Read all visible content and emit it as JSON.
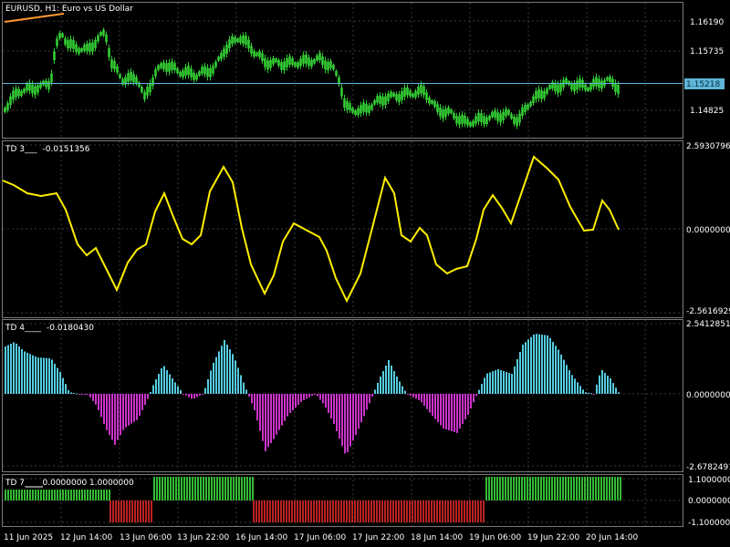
{
  "header": {
    "symbol_line": "EURUSD, H1:  Euro vs US Dollar",
    "price_tag": "1.15218"
  },
  "price_axis": {
    "labels": [
      "1.16190",
      "1.15735",
      "1.14825"
    ]
  },
  "panel_td3": {
    "name": "TD 3___",
    "value": "-0.0151356",
    "axis_labels": [
      "2.5930796",
      "0.0000000",
      "-2.5616929"
    ]
  },
  "panel_td4": {
    "name": "TD 4____",
    "value": "-0.0180430",
    "axis_labels": [
      "2.5412851",
      "0.0000000",
      "-2.6782491"
    ]
  },
  "panel_td7": {
    "name": "TD 7___",
    "values": "0.0000000  1.0000000",
    "axis_labels": [
      "1.1000000",
      "0.0000000",
      "-1.1000000"
    ]
  },
  "time_axis": {
    "labels": [
      "11 Jun 2025",
      "12 Jun 14:00",
      "13 Jun 06:00",
      "13 Jun 22:00",
      "16 Jun 14:00",
      "17 Jun 06:00",
      "17 Jun 22:00",
      "18 Jun 14:00",
      "19 Jun 06:00",
      "19 Jun 22:00",
      "20 Jun 14:00"
    ]
  },
  "colors": {
    "candle": "#33cc33",
    "price_line": "#5fb4d8",
    "td3_line": "#ffee00",
    "td4_positive": "#55cce0",
    "td4_negative": "#cc33cc",
    "td7_positive": "#33bb33",
    "td7_negative": "#bb2222",
    "grid": "#3a3a3a",
    "trend_line": "#ff9933"
  }
}
